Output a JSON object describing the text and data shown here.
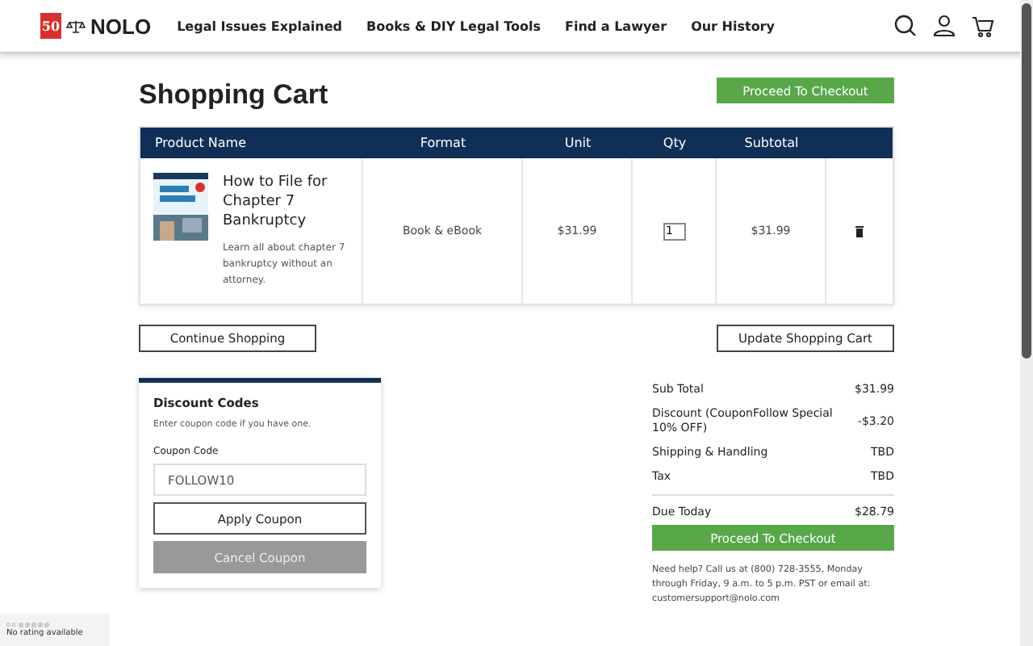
{
  "header": {
    "logo": {
      "badge_number": "50",
      "name": "NOLO"
    },
    "nav": [
      "Legal Issues Explained",
      "Books & DIY Legal Tools",
      "Find a Lawyer",
      "Our History"
    ]
  },
  "page_title": "Shopping Cart",
  "top_button": "Proceed To Checkout",
  "table": {
    "columns": [
      "Product Name",
      "Format",
      "Unit",
      "Qty",
      "Subtotal"
    ],
    "rows": [
      {
        "title": "How to File for Chapter 7 Bankruptcy",
        "description": "Learn all about chapter 7 bankruptcy without an attorney.",
        "format": "Book & eBook",
        "unit": "$31.99",
        "qty": "1",
        "subtotal": "$31.99"
      }
    ]
  },
  "cart_buttons": [
    "Continue Shopping",
    "Update Shopping Cart"
  ],
  "discount": {
    "title": "Discount Codes",
    "hint": "Enter coupon code if you have one.",
    "label": "Coupon Code",
    "value": "FOLLOW10",
    "buttons": [
      {
        "label": "Apply Coupon",
        "disabled": false
      },
      {
        "label": "Cancel Coupon",
        "disabled": true
      }
    ]
  },
  "summary": {
    "lines": [
      {
        "label": "Sub Total",
        "value": "$31.99"
      },
      {
        "label": "Discount (CouponFollow Special 10% OFF)",
        "value": "-$3.20"
      },
      {
        "label": "Shipping & Handling",
        "value": "TBD"
      },
      {
        "label": "Tax",
        "value": "TBD"
      }
    ],
    "total": {
      "label": "Due Today",
      "value": "$28.79"
    },
    "button": "Proceed To Checkout",
    "help": "Need help? Call us at (800) 728-3555, Monday through Friday, 9 a.m. to 5 p.m. PST or email at: customersupport@nolo.com"
  },
  "rating_widget": {
    "score": "0.0",
    "stars": 0,
    "text": "No rating available"
  }
}
